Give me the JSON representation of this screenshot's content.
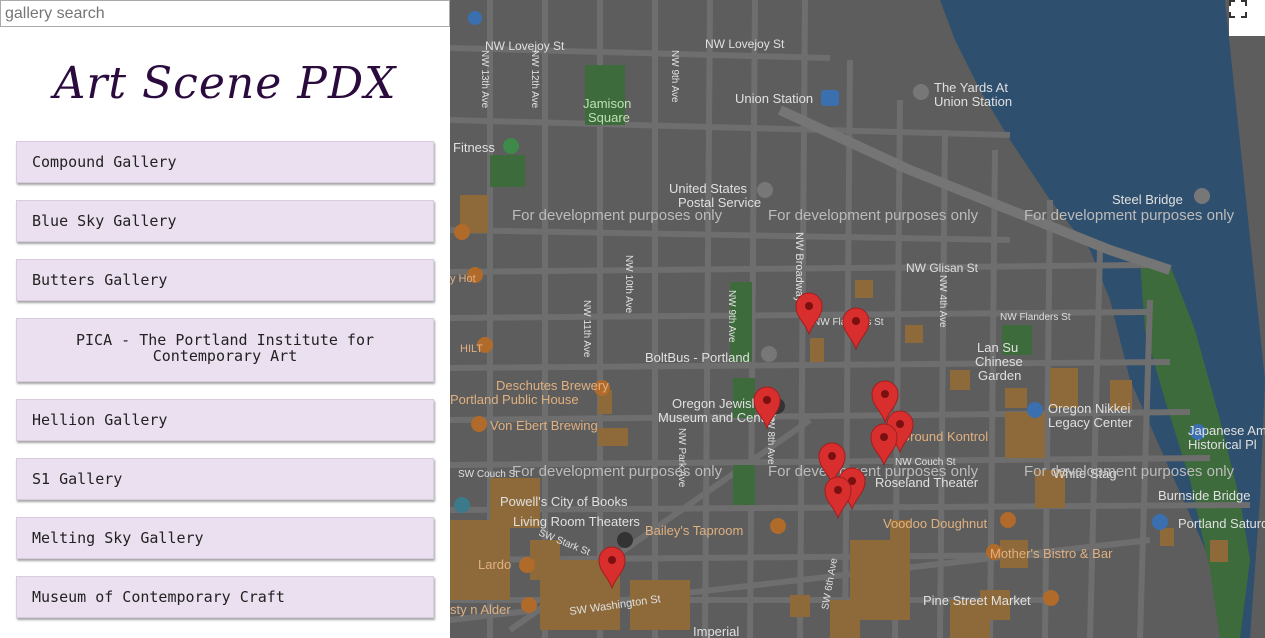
{
  "search": {
    "placeholder": "gallery search"
  },
  "logo": {
    "text": "Art Scene PDX"
  },
  "galleries": [
    "Compound Gallery",
    "Blue Sky Gallery",
    "Butters Gallery",
    "PICA - The Portland Institute for Contemporary Art",
    "Hellion Gallery",
    "S1 Gallery",
    "Melting Sky Gallery",
    "Museum of Contemporary Craft"
  ],
  "map": {
    "watermark": "For development purposes only",
    "labels": {
      "lovejoy1": "NW Lovejoy St",
      "lovejoy2": "NW Lovejoy St",
      "yards": "The Yards At Union Station",
      "union": "Union Station",
      "jamison": "Jamison Square",
      "fitness": "Fitness",
      "usps": "United States Postal Service",
      "steel": "Steel Bridge",
      "glisan": "NW Glisan St",
      "flanders": "NW Flanders St",
      "lansu": "Lan Su Chinese Garden",
      "boltbus": "BoltBus - Portland",
      "deschutes": "Deschutes Brewery Portland Public House",
      "oregonjewish": "Oregon Jewish Museum and Center",
      "nikkei": "Oregon Nikkei Legacy Center",
      "japanese": "Japanese Am Historical Pl",
      "vonebert": "Von Ebert Brewing",
      "groundkontrol": "Ground Kontrol",
      "roseland": "Roseland Theater",
      "whitestag": "White Stag",
      "burnside": "Burnside Bridge",
      "powells": "Powell's City of Books",
      "livingroom": "Living Room Theaters",
      "baileys": "Bailey's Taproom",
      "voodoo": "Voodoo Doughnut",
      "portlandsat": "Portland Saturd",
      "mothers": "Mother's Bistro & Bar",
      "lardo": "Lardo",
      "alder": "sty n Alder",
      "pine": "Pine Street Market",
      "imperial": "Imperial",
      "nw13": "NW 13th Ave",
      "nw12": "NW 12th Ave",
      "nw11": "NW 11th Ave",
      "nw9a": "NW 9th Ave",
      "nw9b": "NW 9th Ave",
      "nw10": "NW 10th Ave",
      "nwbroad": "NW Broadway",
      "nw4": "NW 4th Ave",
      "nwpark": "NW Park Ave",
      "nw8": "NW 8th Ave",
      "nwflanders2": "NW Flanders St",
      "couch": "SW Couch St",
      "couch2": "NW Couch St",
      "sw6": "SW 6th Ave",
      "swstark": "SW Stark St",
      "swwash": "SW Washington St",
      "hilt": "HILT",
      "hotline": "y Hot"
    }
  },
  "colors": {
    "pin": "#d92e2e",
    "sidebar_item": "#ebe0ef",
    "logo": "#2b0b3e"
  }
}
